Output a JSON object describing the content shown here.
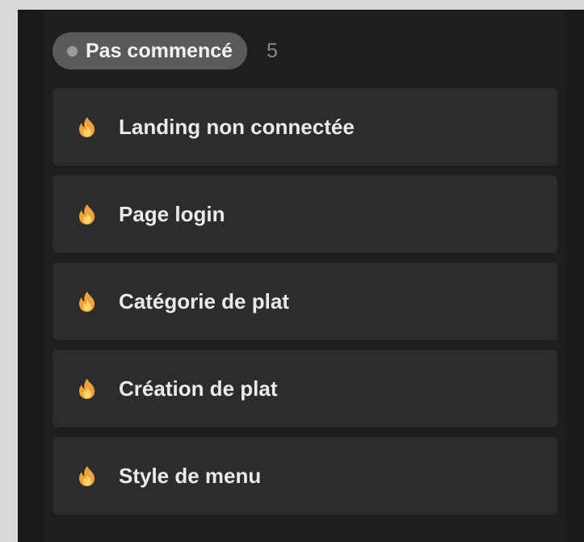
{
  "column": {
    "status": {
      "label": "Pas commencé",
      "count": "5",
      "dot_color": "#9b9b9b"
    },
    "cards": [
      {
        "title": "Landing non connectée",
        "icon": "fire-icon"
      },
      {
        "title": "Page login",
        "icon": "fire-icon"
      },
      {
        "title": "Catégorie de plat",
        "icon": "fire-icon"
      },
      {
        "title": "Création de plat",
        "icon": "fire-icon"
      },
      {
        "title": "Style de menu",
        "icon": "fire-icon"
      }
    ]
  },
  "colors": {
    "card_background": "#2c2c2c",
    "column_background": "#1e1e1e",
    "fire_outer": "#f0a23a",
    "fire_inner": "#ffd56a"
  }
}
